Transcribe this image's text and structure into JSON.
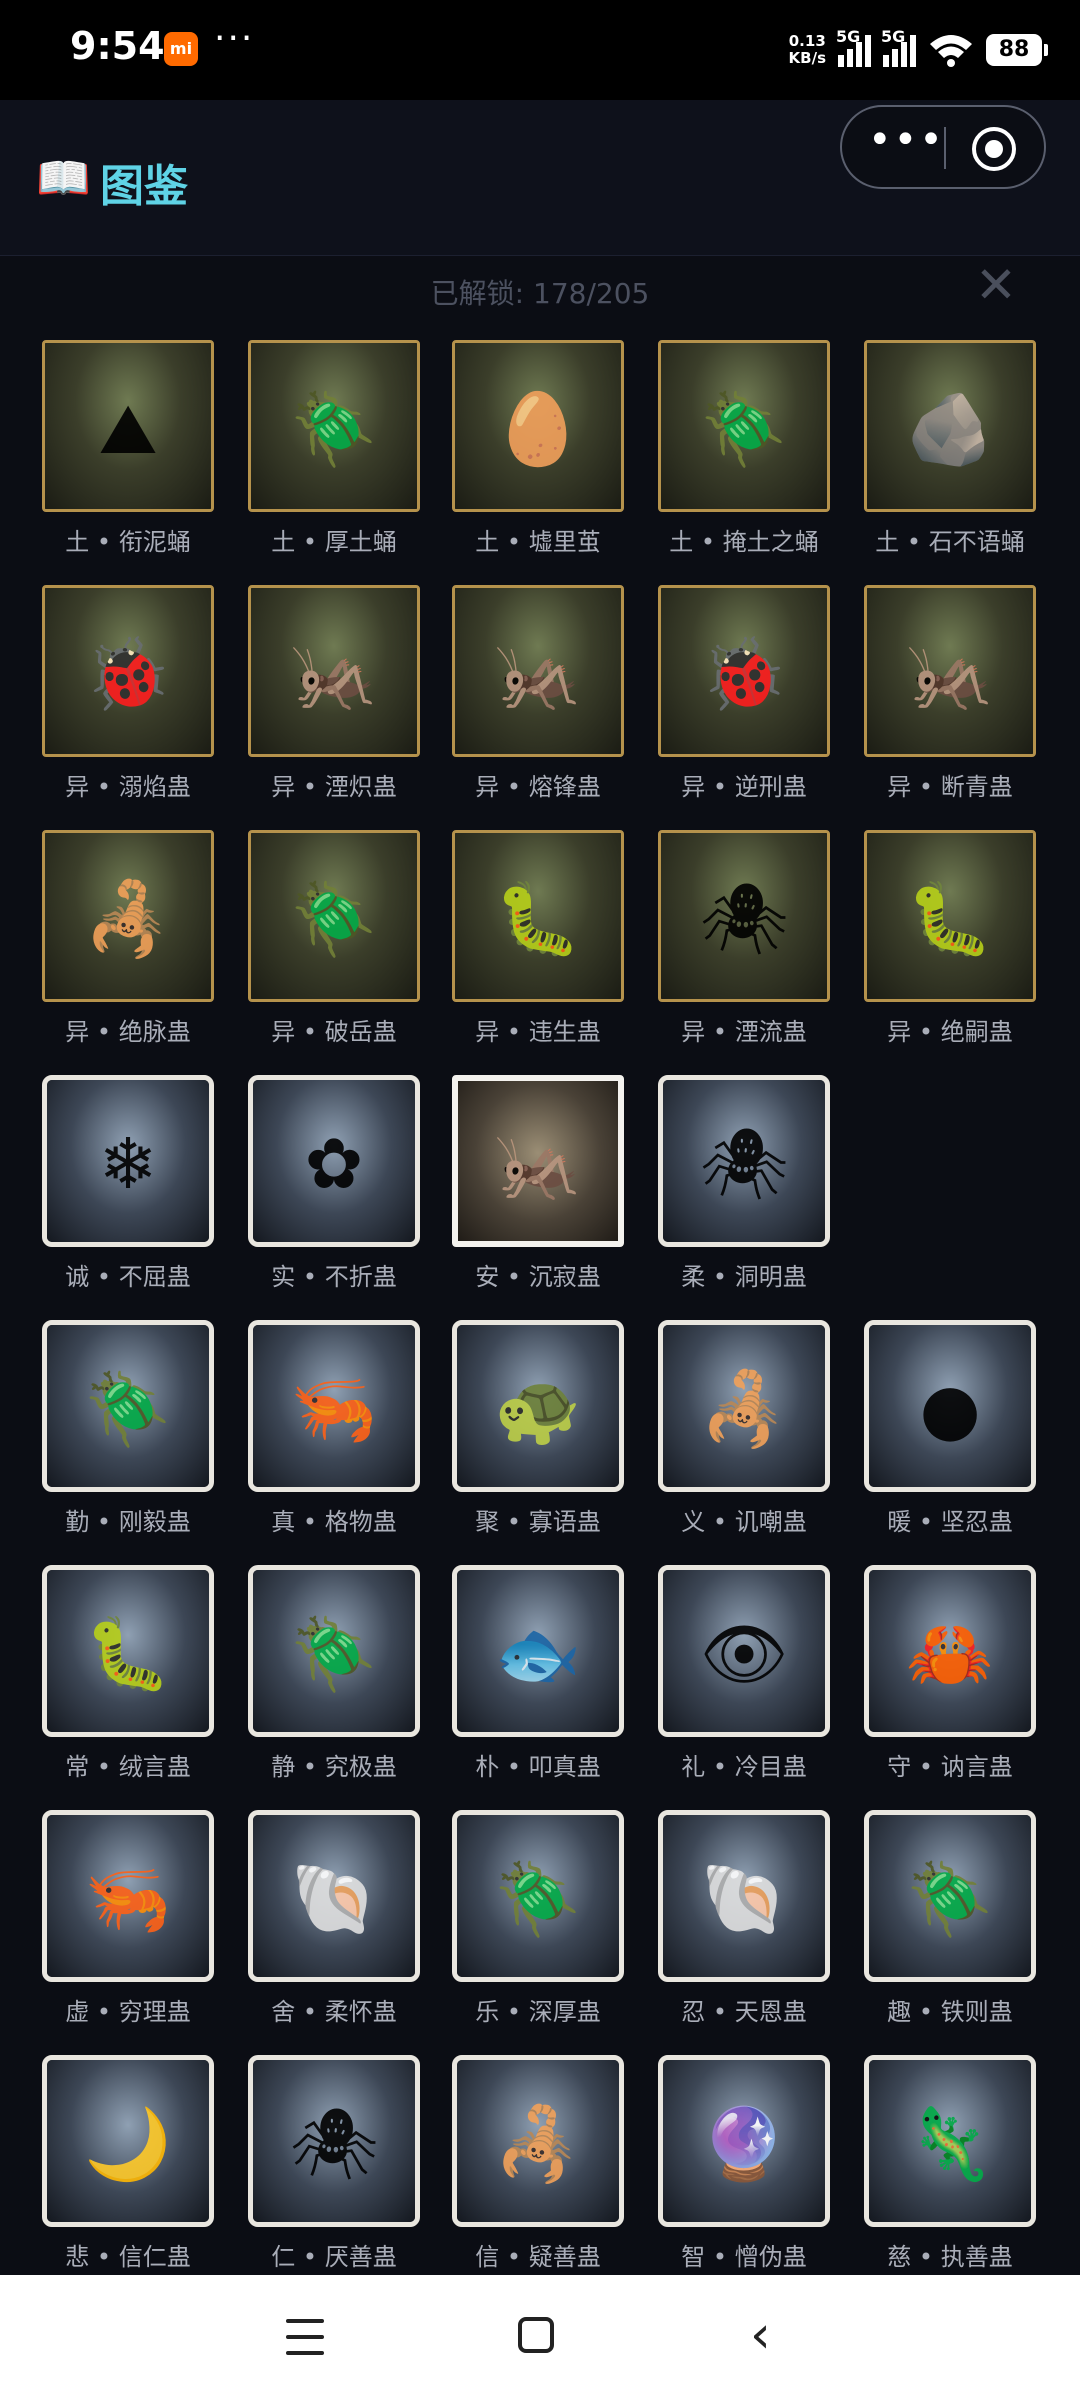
{
  "status_bar": {
    "time": "9:54",
    "app_badge": "mi",
    "dots": "···",
    "speed_value": "0.13",
    "speed_unit": "KB/s",
    "network1": "5G",
    "network2": "5G",
    "battery": "88"
  },
  "header": {
    "icon": "📖",
    "title": "图鉴",
    "capsule_more": "•••",
    "close": "✕"
  },
  "progress_text": "已解锁: 178/205",
  "colors": {
    "accent": "#5fd3e6",
    "bg": "#0b0d14"
  },
  "entries": [
    {
      "label": "土 • 衔泥蛹",
      "frame": "soil",
      "icon": "cocoon",
      "glyph": "⛰"
    },
    {
      "label": "土 • 厚土蛹",
      "frame": "soil",
      "icon": "pupa",
      "glyph": "🪲"
    },
    {
      "label": "土 • 墟里茧",
      "frame": "soil",
      "icon": "cocoon",
      "glyph": "🥚"
    },
    {
      "label": "土 • 掩土之蛹",
      "frame": "soil",
      "icon": "pupa",
      "glyph": "🪲"
    },
    {
      "label": "土 • 石不语蛹",
      "frame": "soil",
      "icon": "stone",
      "glyph": "🪨"
    },
    {
      "label": "异 • 溺焰蛊",
      "frame": "soil",
      "icon": "ladybug",
      "glyph": "🐞"
    },
    {
      "label": "异 • 湮炽蛊",
      "frame": "soil",
      "icon": "locust",
      "glyph": "🦗"
    },
    {
      "label": "异 • 熔锋蛊",
      "frame": "soil",
      "icon": "mantis",
      "glyph": "🦗"
    },
    {
      "label": "异 • 逆刑蛊",
      "frame": "soil",
      "icon": "ladybug",
      "glyph": "🐞"
    },
    {
      "label": "异 • 断青蛊",
      "frame": "soil",
      "icon": "mantis",
      "glyph": "🦗"
    },
    {
      "label": "异 • 绝脉蛊",
      "frame": "soil",
      "icon": "scorpion",
      "glyph": "🦂"
    },
    {
      "label": "异 • 破岳蛊",
      "frame": "soil",
      "icon": "beetle",
      "glyph": "🪲"
    },
    {
      "label": "异 • 违生蛊",
      "frame": "soil",
      "icon": "larva",
      "glyph": "🐛"
    },
    {
      "label": "异 • 湮流蛊",
      "frame": "soil",
      "icon": "spider",
      "glyph": "🕷"
    },
    {
      "label": "异 • 绝嗣蛊",
      "frame": "soil",
      "icon": "larva",
      "glyph": "🐛"
    },
    {
      "label": "诚 • 不屈蛊",
      "frame": "bone",
      "icon": "shrine",
      "glyph": "❄"
    },
    {
      "label": "实 • 不折蛊",
      "frame": "bone",
      "icon": "flower-mantis",
      "glyph": "✿"
    },
    {
      "label": "安 • 沉寂蛊",
      "frame": "plain",
      "icon": "stick-insect",
      "glyph": "🦗"
    },
    {
      "label": "柔 • 洞明蛊",
      "frame": "bone",
      "icon": "glow-spider",
      "glyph": "🕷"
    },
    {
      "label": "勤 • 刚毅蛊",
      "frame": "bone",
      "icon": "beetle",
      "glyph": "🪲"
    },
    {
      "label": "真 • 格物蛊",
      "frame": "bone",
      "icon": "shrimp",
      "glyph": "🦐"
    },
    {
      "label": "聚 • 寡语蛊",
      "frame": "bone",
      "icon": "shell-bug",
      "glyph": "🐢"
    },
    {
      "label": "义 • 讥嘲蛊",
      "frame": "bone",
      "icon": "scorpion",
      "glyph": "🦂"
    },
    {
      "label": "暖 • 坚忍蛊",
      "frame": "bone",
      "icon": "glow-grub",
      "glyph": "●"
    },
    {
      "label": "常 • 绒言蛊",
      "frame": "bone",
      "icon": "centipede",
      "glyph": "🐛"
    },
    {
      "label": "静 • 究极蛊",
      "frame": "bone",
      "icon": "beetle",
      "glyph": "🪲"
    },
    {
      "label": "朴 • 叩真蛊",
      "frame": "bone",
      "icon": "fish",
      "glyph": "🐟"
    },
    {
      "label": "礼 • 冷目蛊",
      "frame": "bone",
      "icon": "eye-spider",
      "glyph": "👁"
    },
    {
      "label": "守 • 讷言蛊",
      "frame": "bone",
      "icon": "crab",
      "glyph": "🦀"
    },
    {
      "label": "虚 • 穷理蛊",
      "frame": "bone",
      "icon": "winged-shrimp",
      "glyph": "🦐"
    },
    {
      "label": "舍 • 柔怀蛊",
      "frame": "bone",
      "icon": "shell-creature",
      "glyph": "🐚"
    },
    {
      "label": "乐 • 深厚蛊",
      "frame": "bone",
      "icon": "isopod",
      "glyph": "🪲"
    },
    {
      "label": "忍 • 天恩蛊",
      "frame": "bone",
      "icon": "spiral-shell",
      "glyph": "🐚"
    },
    {
      "label": "趣 • 铁则蛊",
      "frame": "bone",
      "icon": "armadillo",
      "glyph": "🪲"
    },
    {
      "label": "悲 • 信仁蛊",
      "frame": "bone",
      "icon": "glow-larva",
      "glyph": "🌙"
    },
    {
      "label": "仁 • 厌善蛊",
      "frame": "bone",
      "icon": "crab-spider",
      "glyph": "🕷"
    },
    {
      "label": "信 • 疑善蛊",
      "frame": "bone",
      "icon": "seahorse-bug",
      "glyph": "🦂"
    },
    {
      "label": "智 • 憎伪蛊",
      "frame": "bone",
      "icon": "ant-orb",
      "glyph": "🔮"
    },
    {
      "label": "慈 • 执善蛊",
      "frame": "bone",
      "icon": "axolotl",
      "glyph": "🦎"
    }
  ],
  "navbar": {
    "menu": "menu-icon",
    "home": "home-icon",
    "back": "‹"
  }
}
